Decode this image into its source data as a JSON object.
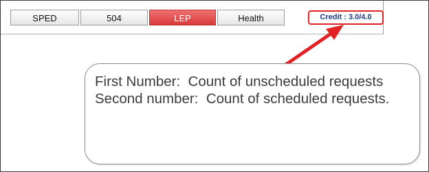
{
  "tabs": [
    {
      "label": "SPED",
      "active": false
    },
    {
      "label": "504",
      "active": false
    },
    {
      "label": "LEP",
      "active": true
    },
    {
      "label": "Health",
      "active": false
    }
  ],
  "credit": {
    "text": "Credit : 3.0/4.0",
    "unscheduled_count": 3.0,
    "scheduled_count": 4.0
  },
  "callout": {
    "line1": "First Number:  Count of unscheduled requests",
    "line2": "Second number:  Count of scheduled requests."
  },
  "colors": {
    "active_tab": "#e04848",
    "highlight_border": "#e22222",
    "arrow": "#e22222",
    "credit_text": "#1f3a8c"
  },
  "icons": {
    "arrow": "red-annotation-arrow-icon"
  }
}
